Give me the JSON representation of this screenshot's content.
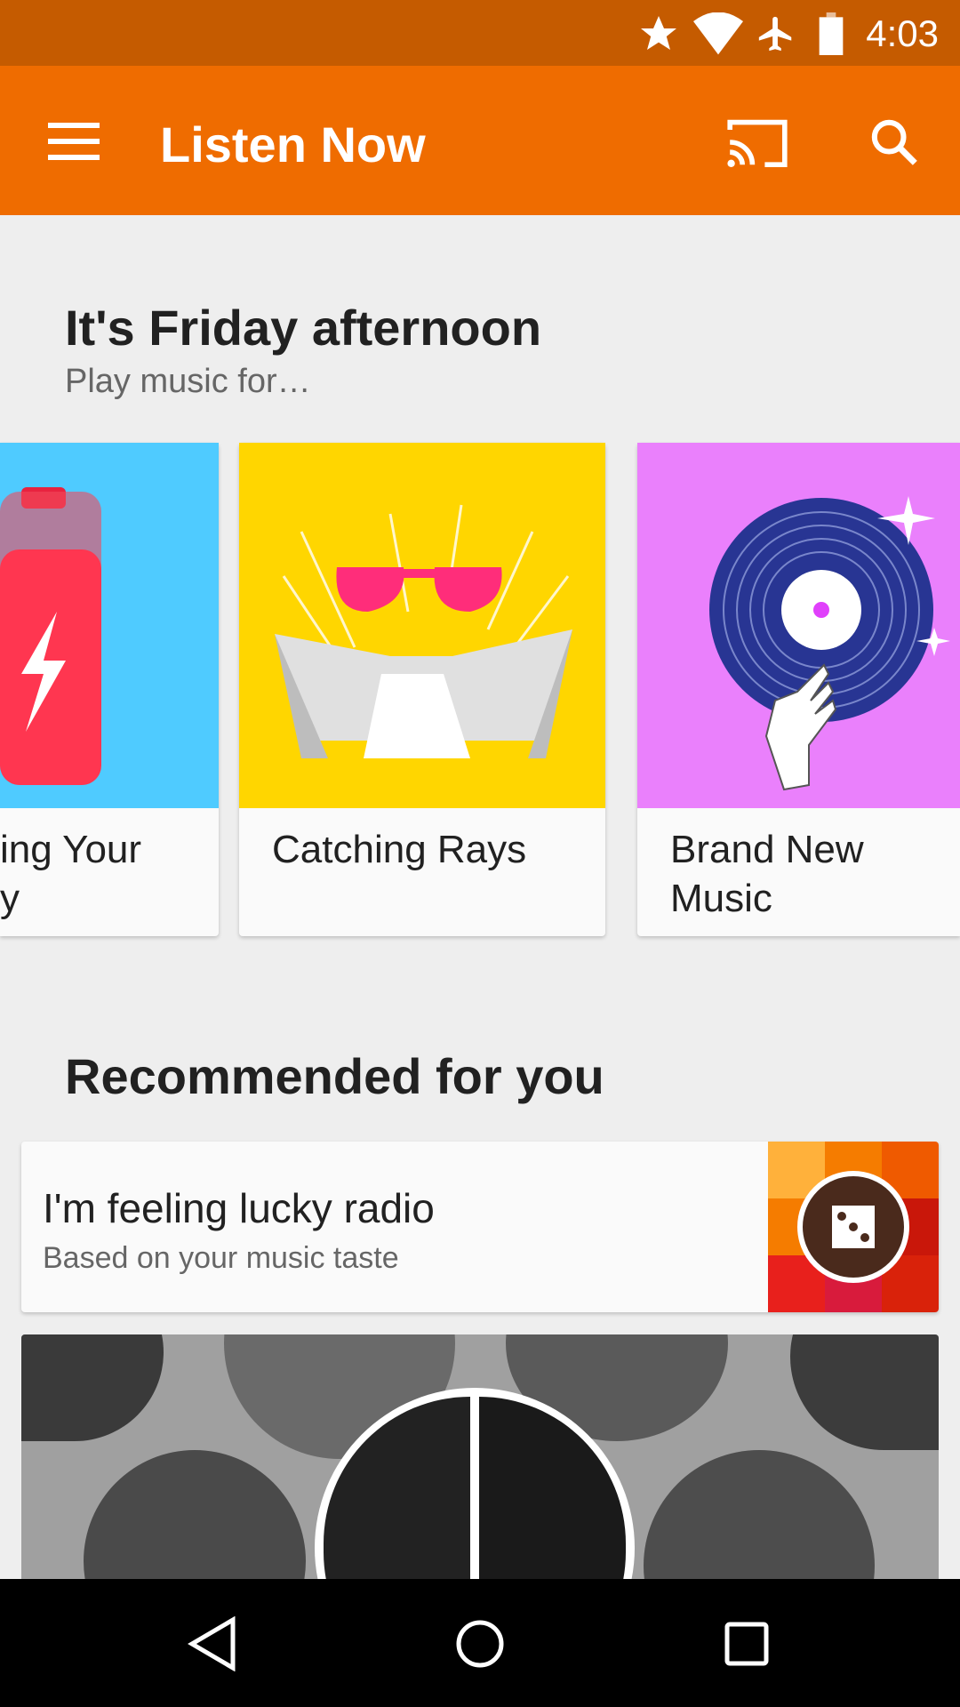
{
  "status_bar": {
    "time": "4:03",
    "icons": [
      "star-icon",
      "wifi-icon",
      "airplane-icon",
      "battery-icon"
    ]
  },
  "app_bar": {
    "title": "Listen Now",
    "icons": [
      "menu-icon",
      "cast-icon",
      "search-icon"
    ]
  },
  "section1": {
    "title": "It's Friday afternoon",
    "subtitle": "Play music for…",
    "cards": [
      {
        "label": "Charging Your Day",
        "visible_label": "ing Your\ny",
        "color": "#4fcbff"
      },
      {
        "label": "Catching Rays",
        "color": "#ffd600"
      },
      {
        "label": "Brand New Music",
        "color": "#ea80fc"
      }
    ]
  },
  "section2": {
    "title": "Recommended for you",
    "lucky": {
      "title": "I'm feeling lucky radio",
      "subtitle": "Based on your music taste",
      "icon": "dice-icon",
      "tiles": [
        "#ffb13b",
        "#f57c00",
        "#ef5a00",
        "#f57c00",
        "#e65100",
        "#c9170a",
        "#e8201c",
        "#d81b3c",
        "#d9220a"
      ]
    }
  },
  "colors": {
    "status": "#c55b00",
    "accent": "#ef6c00"
  }
}
